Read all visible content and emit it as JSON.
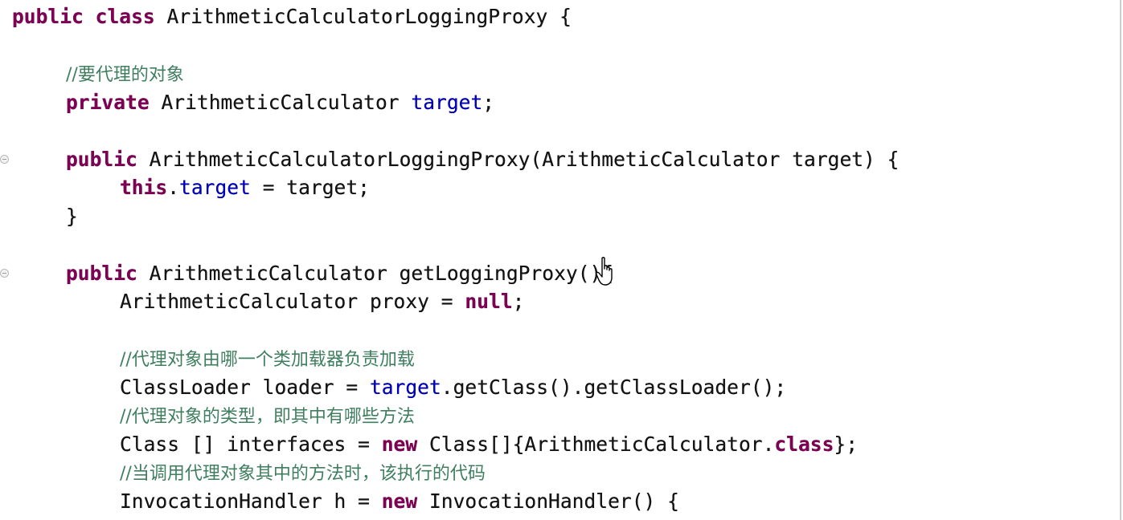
{
  "editor": {
    "lines": [
      {
        "indent": "",
        "tokens": [
          {
            "t": "public",
            "k": "kw"
          },
          {
            "t": " ",
            "k": "plain"
          },
          {
            "t": "class",
            "k": "kw"
          },
          {
            "t": " ArithmeticCalculatorLoggingProxy {",
            "k": "plain"
          }
        ]
      },
      {
        "indent": "",
        "tokens": []
      },
      {
        "indent": "    ",
        "tokens": [
          {
            "t": "//要代理的对象",
            "k": "comment"
          }
        ]
      },
      {
        "indent": "    ",
        "tokens": [
          {
            "t": "private",
            "k": "kw"
          },
          {
            "t": " ArithmeticCalculator ",
            "k": "plain"
          },
          {
            "t": "target",
            "k": "field"
          },
          {
            "t": ";",
            "k": "plain"
          }
        ]
      },
      {
        "indent": "",
        "tokens": []
      },
      {
        "indent": "    ",
        "tokens": [
          {
            "t": "public",
            "k": "kw"
          },
          {
            "t": " ArithmeticCalculatorLoggingProxy(ArithmeticCalculator target) {",
            "k": "plain"
          }
        ]
      },
      {
        "indent": "        ",
        "tokens": [
          {
            "t": "this",
            "k": "kw"
          },
          {
            "t": ".",
            "k": "plain"
          },
          {
            "t": "target",
            "k": "field"
          },
          {
            "t": " = target;",
            "k": "plain"
          }
        ]
      },
      {
        "indent": "    ",
        "tokens": [
          {
            "t": "}",
            "k": "plain"
          }
        ]
      },
      {
        "indent": "",
        "tokens": []
      },
      {
        "indent": "    ",
        "tokens": [
          {
            "t": "public",
            "k": "kw"
          },
          {
            "t": " ArithmeticCalculator getLoggingProxy(){",
            "k": "plain"
          }
        ]
      },
      {
        "indent": "        ",
        "tokens": [
          {
            "t": "ArithmeticCalculator proxy = ",
            "k": "plain"
          },
          {
            "t": "null",
            "k": "kw"
          },
          {
            "t": ";",
            "k": "plain"
          }
        ]
      },
      {
        "indent": "",
        "tokens": []
      },
      {
        "indent": "        ",
        "tokens": [
          {
            "t": "//代理对象由哪一个类加载器负责加载",
            "k": "comment"
          }
        ]
      },
      {
        "indent": "        ",
        "tokens": [
          {
            "t": "ClassLoader loader = ",
            "k": "plain"
          },
          {
            "t": "target",
            "k": "field"
          },
          {
            "t": ".getClass().getClassLoader();",
            "k": "plain"
          }
        ]
      },
      {
        "indent": "        ",
        "tokens": [
          {
            "t": "//代理对象的类型，即其中有哪些方法",
            "k": "comment"
          }
        ]
      },
      {
        "indent": "        ",
        "tokens": [
          {
            "t": "Class [] interfaces = ",
            "k": "plain"
          },
          {
            "t": "new",
            "k": "kw"
          },
          {
            "t": " Class[]{ArithmeticCalculator.",
            "k": "plain"
          },
          {
            "t": "class",
            "k": "kw"
          },
          {
            "t": "};",
            "k": "plain"
          }
        ]
      },
      {
        "indent": "        ",
        "tokens": [
          {
            "t": "//当调用代理对象其中的方法时，该执行的代码",
            "k": "comment"
          }
        ]
      },
      {
        "indent": "        ",
        "tokens": [
          {
            "t": "InvocationHandler h = ",
            "k": "plain"
          },
          {
            "t": "new",
            "k": "kw"
          },
          {
            "t": " InvocationHandler() {",
            "k": "plain"
          }
        ]
      }
    ],
    "fold_markers": [
      5,
      9
    ]
  }
}
